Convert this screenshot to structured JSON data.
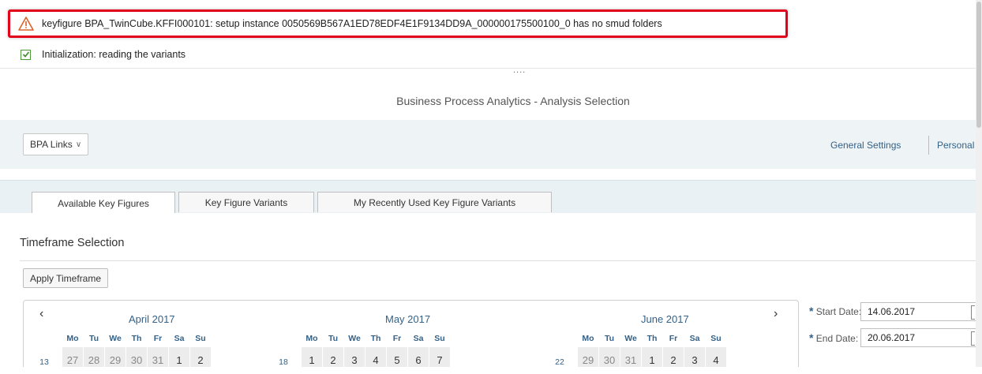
{
  "messages": {
    "error_text": "keyfigure BPA_TwinCube.KFFI000101: setup instance 0050569B567A1ED78EDF4E1F9134DD9A_000000175500100_0 has no smud folders",
    "info_text": "Initialization: reading the variants",
    "splitter": "...."
  },
  "app": {
    "title": "Business Process Analytics - Analysis Selection"
  },
  "links": {
    "bpa_links": "BPA Links",
    "general_settings": "General Settings",
    "personalize": "Personal"
  },
  "tabs": [
    "Available Key Figures",
    "Key Figure Variants",
    "My Recently Used Key Figure Variants"
  ],
  "timeframe": {
    "title": "Timeframe Selection",
    "apply_button": "Apply Timeframe",
    "start_label": "Start Date:",
    "start_value": "14.06.2017",
    "end_label": "End Date:",
    "end_value": "20.06.2017"
  },
  "calendar": {
    "prev": "‹",
    "next": "›",
    "day_headers": [
      "Mo",
      "Tu",
      "We",
      "Th",
      "Fr",
      "Sa",
      "Su"
    ],
    "months": [
      {
        "name": "April 2017",
        "week": "13",
        "days": [
          "27",
          "28",
          "29",
          "30",
          "31",
          "1",
          "2"
        ]
      },
      {
        "name": "May 2017",
        "week": "18",
        "days": [
          "1",
          "2",
          "3",
          "4",
          "5",
          "6",
          "7"
        ]
      },
      {
        "name": "June 2017",
        "week": "22",
        "days": [
          "29",
          "30",
          "31",
          "1",
          "2",
          "3",
          "4"
        ]
      }
    ]
  }
}
